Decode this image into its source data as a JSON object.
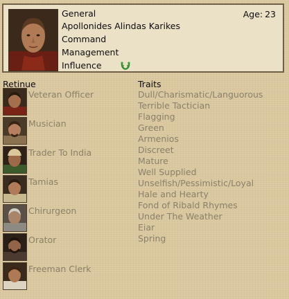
{
  "character": {
    "title": "General",
    "age_label": "Age:",
    "age_value": "23",
    "name": "Apollonides Alindas Karikes",
    "command_label": "Command",
    "management_label": "Management",
    "influence_label": "Influence",
    "influence_icon": "laurel-wreath-icon"
  },
  "columns": {
    "retinue_label": "Retinue",
    "traits_label": "Traits"
  },
  "retinue": [
    {
      "label": "Veteran Officer"
    },
    {
      "label": "Musician"
    },
    {
      "label": "Trader To India"
    },
    {
      "label": "Tamias"
    },
    {
      "label": "Chirurgeon"
    },
    {
      "label": "Orator"
    },
    {
      "label": "Freeman Clerk"
    }
  ],
  "traits": [
    "Dull/Charismatic/Languorous",
    "Terrible Tactician",
    "Flagging",
    "Green",
    "Armenios",
    "Discreet",
    "Mature",
    "Well Supplied",
    "Unselfish/Pessimistic/Loyal",
    "Hale and Hearty",
    "Fond of Ribald Rhymes",
    "Under The Weather",
    "Eiar",
    "Spring"
  ],
  "colors": {
    "background": "#dccaa3",
    "panel": "#ebe1c7",
    "text_dark": "#0c0c0c",
    "text_muted": "#8a8069",
    "laurel": "#2f8a2a"
  }
}
